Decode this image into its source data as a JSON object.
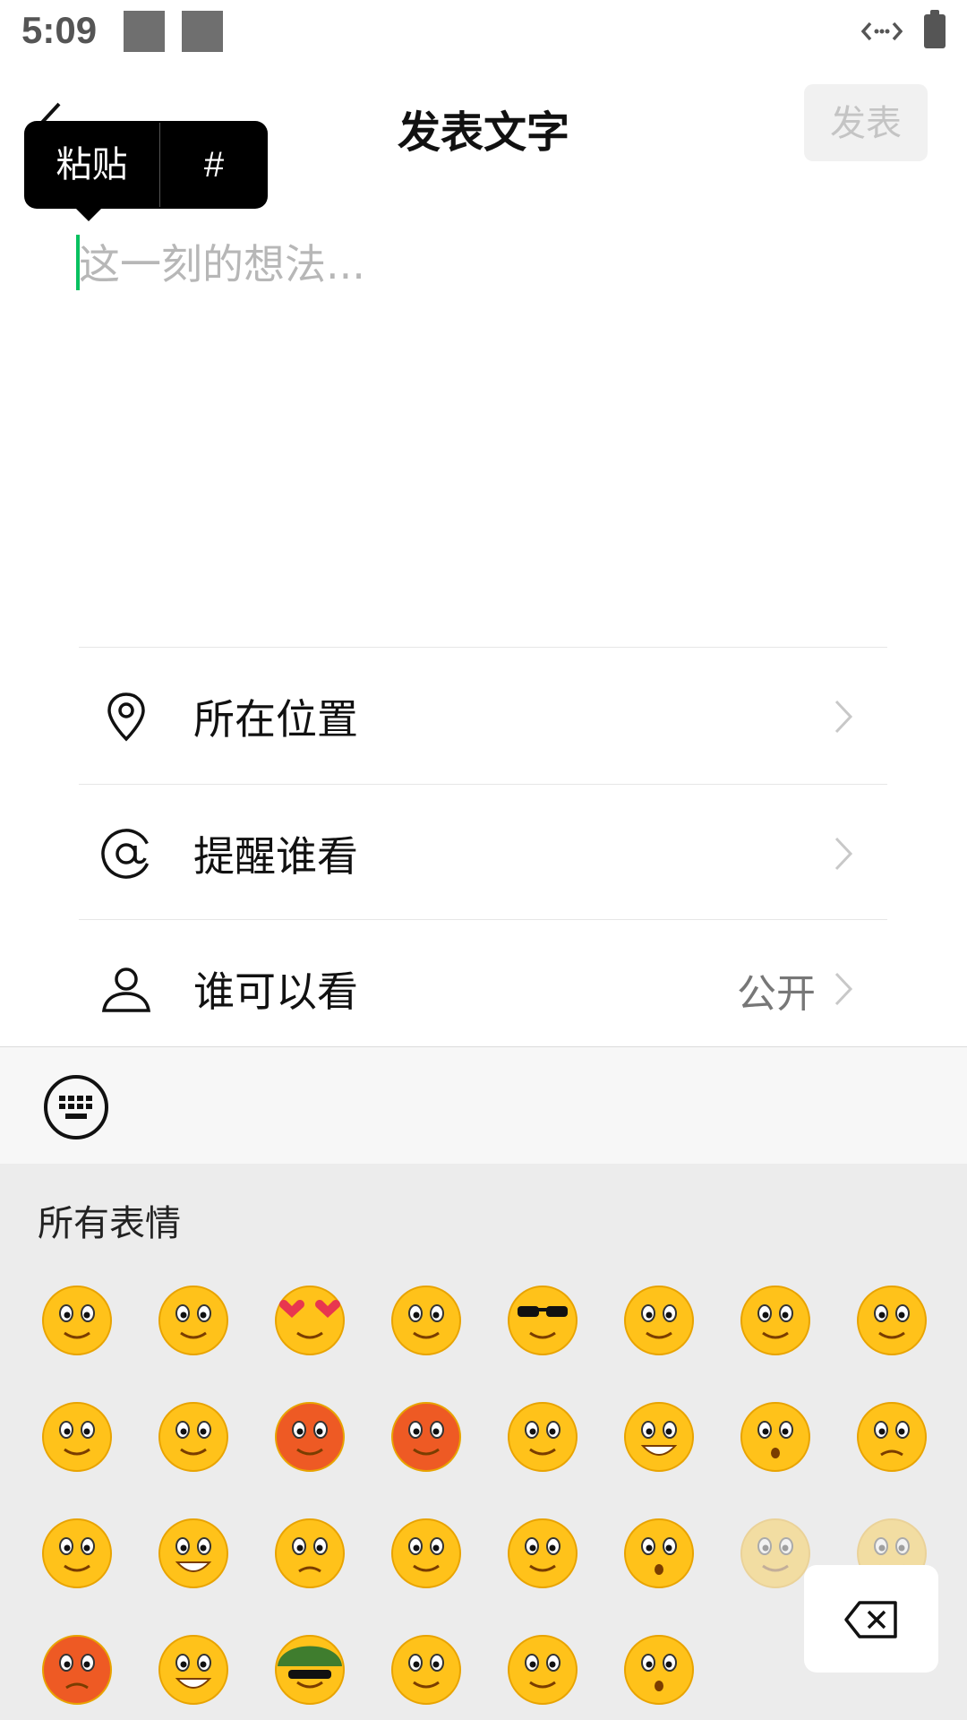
{
  "status_bar": {
    "time": "5:09",
    "icons": [
      "notification-square-icon",
      "notification-square-icon",
      "data-transfer-icon",
      "battery-icon"
    ]
  },
  "header": {
    "title": "发表文字",
    "publish_label": "发表",
    "back_icon": "chevron-left-icon"
  },
  "paste_popup": {
    "paste_label": "粘贴",
    "hash_label": "#"
  },
  "composer": {
    "placeholder": "这一刻的想法..."
  },
  "options": {
    "location": {
      "label": "所在位置",
      "icon": "location-pin-icon"
    },
    "mention": {
      "label": "提醒谁看",
      "icon": "at-icon"
    },
    "visibility": {
      "label": "谁可以看",
      "value": "公开",
      "icon": "person-icon"
    }
  },
  "toolbar": {
    "keyboard_icon": "keyboard-icon"
  },
  "emoji_panel": {
    "title": "所有表情",
    "colors": {
      "face": "#ffc21a",
      "face_dark": "#e8a300",
      "red_face": "#ee5a24"
    },
    "rows": [
      [
        "smile",
        "grimace",
        "heart-eyes",
        "stare",
        "cool",
        "crying",
        "shy",
        "silent"
      ],
      [
        "sleepy",
        "tears",
        "sweat",
        "angry",
        "tongue",
        "grin",
        "surprised",
        "sad"
      ],
      [
        "blush",
        "laugh",
        "queasy",
        "thinking",
        "happy",
        "speechless",
        "skeptical-faded",
        "rolling-eyes-faded"
      ],
      [
        "cursing",
        "chuckle",
        "soldier",
        "sob",
        "confused",
        "shush"
      ]
    ],
    "delete_icon": "backspace-icon"
  }
}
